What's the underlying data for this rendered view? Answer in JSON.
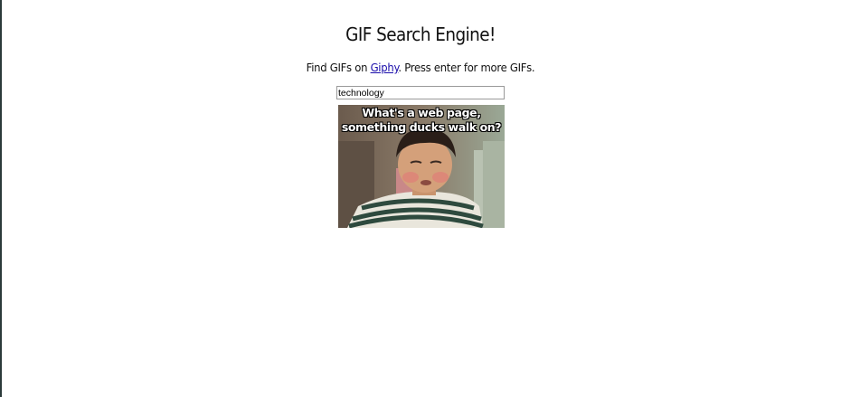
{
  "header": {
    "title": "GIF Search Engine!",
    "subtitle_prefix": "Find GIFs on ",
    "subtitle_link": "Giphy",
    "subtitle_suffix": ". Press enter for more GIFs."
  },
  "search": {
    "value": "technology"
  },
  "gif": {
    "caption_line1": "What's a web page,",
    "caption_line2": "something ducks walk on?"
  }
}
